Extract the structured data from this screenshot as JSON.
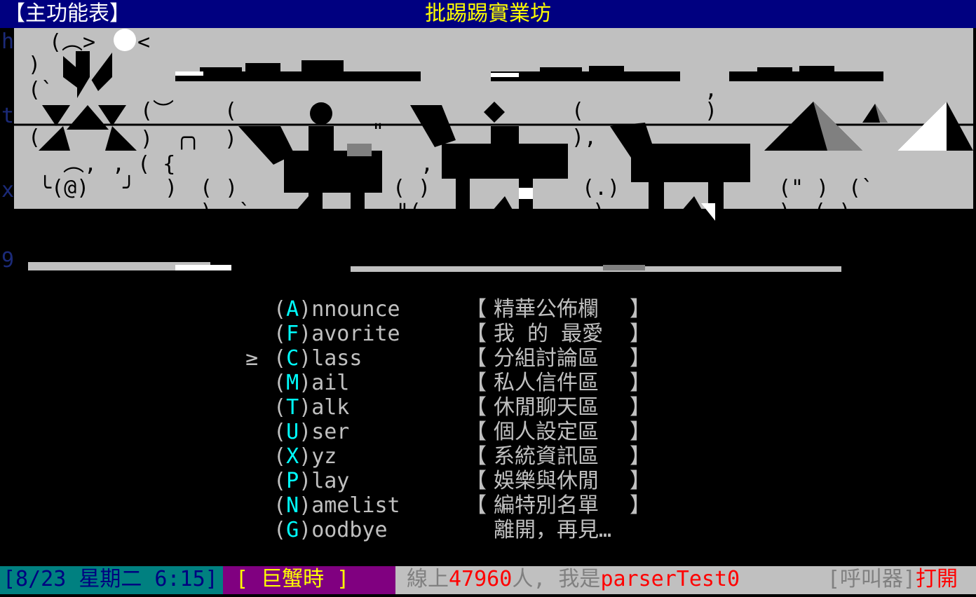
{
  "header": {
    "menu_title": "【主功能表】",
    "bbs_name": "批踢踢實業坊"
  },
  "banner": {
    "side_letters": [
      "h",
      "t",
      "x",
      "9"
    ]
  },
  "menu": {
    "cursor": "≥",
    "selected_index": 2,
    "items": [
      {
        "key": "A",
        "rest": "nnounce",
        "desc": "精華公佈欄",
        "bracketed": true
      },
      {
        "key": "F",
        "rest": "avorite",
        "desc": "我 的 最愛",
        "bracketed": true
      },
      {
        "key": "C",
        "rest": "lass",
        "desc": "分組討論區",
        "bracketed": true
      },
      {
        "key": "M",
        "rest": "ail",
        "desc": "私人信件區",
        "bracketed": true
      },
      {
        "key": "T",
        "rest": "alk",
        "desc": "休閒聊天區",
        "bracketed": true
      },
      {
        "key": "U",
        "rest": "ser",
        "desc": "個人設定區",
        "bracketed": true
      },
      {
        "key": "X",
        "rest": "yz",
        "desc": "系統資訊區",
        "bracketed": true
      },
      {
        "key": "P",
        "rest": "lay",
        "desc": "娛樂與休閒",
        "bracketed": true
      },
      {
        "key": "N",
        "rest": "amelist",
        "desc": "編特別名單",
        "bracketed": true
      },
      {
        "key": "G",
        "rest": "oodbye",
        "desc": "離開，再見…",
        "bracketed": false
      }
    ]
  },
  "footer": {
    "date": "[8/23 星期二 6:15]",
    "zodiac": "[ 巨蟹時 ]",
    "online_prefix": "線上",
    "online_count": "47960",
    "online_mid": "人, 我是",
    "user_id": "parserTest0",
    "pager_label": "[呼叫器]",
    "pager_state": "打開"
  },
  "colors": {
    "title_bg": "#000080",
    "title_name": "#ffff00",
    "hotkey": "#00ffff",
    "banner_fill": "#c0c0c0",
    "date_bg": "#008080",
    "zodiac_bg": "#800080",
    "footer_bg": "#c0c0c0",
    "highlight_red": "#ff0000"
  }
}
